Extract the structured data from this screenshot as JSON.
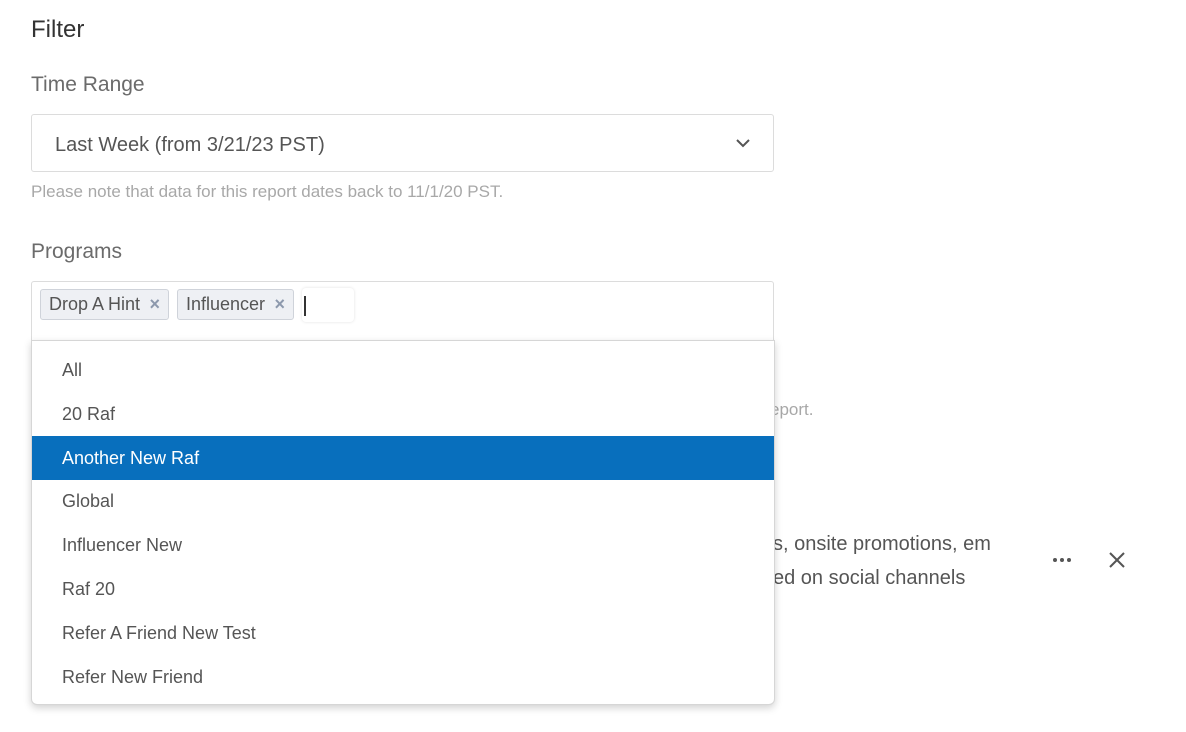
{
  "filter": {
    "title": "Filter"
  },
  "time_range": {
    "label": "Time Range",
    "selected": "Last Week (from 3/21/23 PST)",
    "note": "Please note that data for this report dates back to 11/1/20 PST."
  },
  "programs": {
    "label": "Programs",
    "chips": [
      {
        "label": "Drop A Hint",
        "remove": "×"
      },
      {
        "label": "Influencer",
        "remove": "×"
      }
    ],
    "options": [
      {
        "label": "All",
        "highlighted": false
      },
      {
        "label": "20 Raf",
        "highlighted": false
      },
      {
        "label": "Another New Raf",
        "highlighted": true
      },
      {
        "label": "Global",
        "highlighted": false
      },
      {
        "label": "Influencer New",
        "highlighted": false
      },
      {
        "label": "Raf 20",
        "highlighted": false
      },
      {
        "label": "Refer A Friend New Test",
        "highlighted": false
      },
      {
        "label": "Refer New Friend",
        "highlighted": false
      }
    ]
  },
  "background": {
    "partial_note": "eport.",
    "partial_line1": "s, onsite promotions, em",
    "partial_line2": "ed on social channels"
  },
  "colors": {
    "highlight": "#086fbd",
    "chip_bg": "#eef0f4",
    "chip_x": "#8d99ad"
  },
  "icons": {
    "select_chevron": "chevron-down-icon",
    "more": "more-horizontal-icon",
    "close": "close-icon"
  }
}
